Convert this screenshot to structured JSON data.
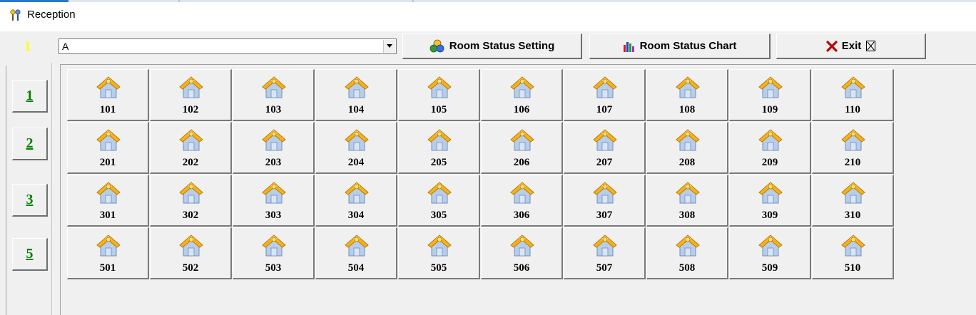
{
  "window": {
    "title": "Reception"
  },
  "toolbar": {
    "current_floor": "1",
    "building_select": {
      "value": "A"
    },
    "room_status_setting_label": "Room Status Setting",
    "room_status_chart_label": "Room Status Chart",
    "exit_label": "Exit",
    "exit_icon": "close-box-icon"
  },
  "floors": [
    "1",
    "2",
    "3",
    "5"
  ],
  "rooms": [
    [
      "101",
      "102",
      "103",
      "104",
      "105",
      "106",
      "107",
      "108",
      "109",
      "110"
    ],
    [
      "201",
      "202",
      "203",
      "204",
      "205",
      "206",
      "207",
      "208",
      "209",
      "210"
    ],
    [
      "301",
      "302",
      "303",
      "304",
      "305",
      "306",
      "307",
      "308",
      "309",
      "310"
    ],
    [
      "501",
      "502",
      "503",
      "504",
      "505",
      "506",
      "507",
      "508",
      "509",
      "510"
    ]
  ],
  "colors": {
    "floor_indicator": "#ffff00",
    "floor_link": "#008000",
    "house_roof": "#f3b21e",
    "house_wall": "#b8cde8"
  }
}
